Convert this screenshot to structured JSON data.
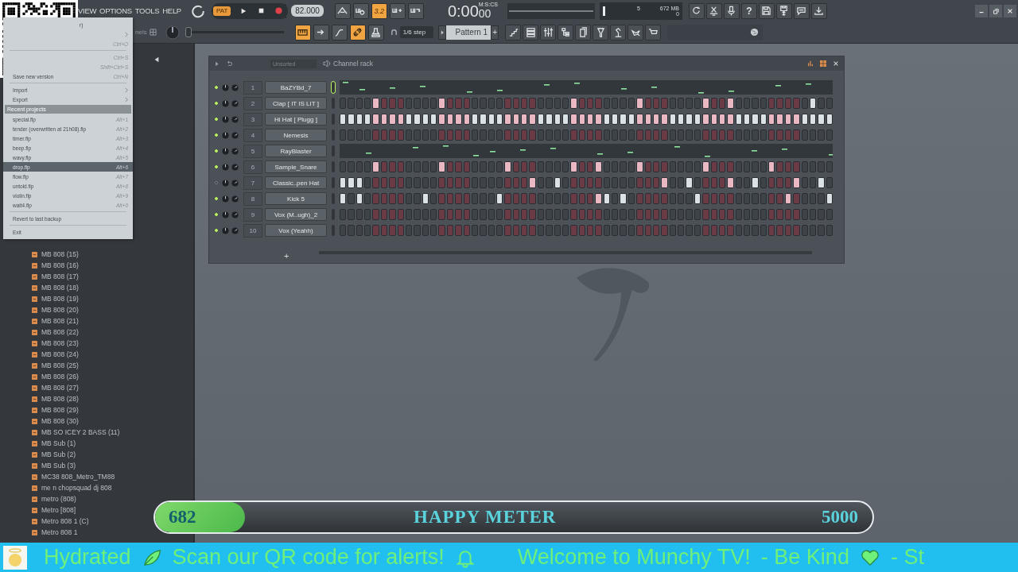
{
  "menu_bar": {
    "items": [
      "VIEW",
      "OPTIONS",
      "TOOLS",
      "HELP"
    ]
  },
  "transport": {
    "mode": "PAT",
    "tempo": "82.000"
  },
  "tools_top": [
    {
      "on": false
    },
    {
      "on": false
    },
    {
      "on": true,
      "label": "3.2"
    },
    {
      "on": false
    },
    {
      "on": false
    }
  ],
  "time": {
    "value": "0:00",
    "centis": "00",
    "unit": "M:S:CS"
  },
  "cpu": {
    "polyphony": "5",
    "memory": "672 MB",
    "value": "0"
  },
  "help_button": "?",
  "toolbar2": {
    "channels_label": "nels",
    "master_slider": {
      "level": 0
    },
    "snap": "1/6 step",
    "pattern": "Pattern 1",
    "add": "+"
  },
  "tools_bottom": [
    {
      "on": true
    },
    {
      "on": false
    },
    {
      "on": false
    },
    {
      "on": true
    },
    {
      "on": false
    }
  ],
  "file_menu": {
    "items": [
      {
        "kind": "item",
        "tail": "r)",
        "selected": false
      },
      {
        "kind": "item",
        "submenu": true,
        "selected": false
      },
      {
        "kind": "item",
        "shortcut": "Ctrl+O",
        "selected": false
      },
      {
        "kind": "separator"
      },
      {
        "kind": "item",
        "shortcut": "Ctrl+S",
        "selected": false
      },
      {
        "kind": "item",
        "shortcut": "Shift+Ctrl+S",
        "selected": false
      },
      {
        "kind": "item",
        "label": "Save new version",
        "shortcut": "Ctrl+N",
        "selected": false
      },
      {
        "kind": "separator"
      },
      {
        "kind": "item",
        "label": "Import",
        "submenu": true,
        "selected": false
      },
      {
        "kind": "item",
        "label": "Export",
        "submenu": true,
        "selected": false
      },
      {
        "kind": "header",
        "label": "Recent projects"
      },
      {
        "kind": "item",
        "label": "special.flp",
        "shortcut": "Alt+1",
        "selected": false
      },
      {
        "kind": "item",
        "label": "tender (overwritten at 21h08).flp",
        "shortcut": "Alt+2",
        "selected": false
      },
      {
        "kind": "item",
        "label": "timer.flp",
        "shortcut": "Alt+3",
        "selected": false
      },
      {
        "kind": "item",
        "label": "beep.flp",
        "shortcut": "Alt+4",
        "selected": false
      },
      {
        "kind": "item",
        "label": "wavy.flp",
        "shortcut": "Alt+5",
        "selected": false
      },
      {
        "kind": "item",
        "label": "drop.flp",
        "shortcut": "Alt+6",
        "selected": true
      },
      {
        "kind": "item",
        "label": "flow.flp",
        "shortcut": "Alt+7",
        "selected": false
      },
      {
        "kind": "item",
        "label": "untold.flp",
        "shortcut": "Alt+8",
        "selected": false
      },
      {
        "kind": "item",
        "label": "violin.flp",
        "shortcut": "Alt+9",
        "selected": false
      },
      {
        "kind": "item",
        "label": "wait4.flp",
        "shortcut": "Alt+0",
        "selected": false
      },
      {
        "kind": "separator"
      },
      {
        "kind": "item",
        "label": "Revert to last backup",
        "selected": false
      },
      {
        "kind": "separator"
      },
      {
        "kind": "item",
        "label": "Exit",
        "selected": false
      }
    ]
  },
  "browser": {
    "items": [
      "MB 808 (15)",
      "MB 808 (16)",
      "MB 808 (17)",
      "MB 808 (18)",
      "MB 808 (19)",
      "MB 808 (20)",
      "MB 808 (21)",
      "MB 808 (22)",
      "MB 808 (23)",
      "MB 808 (24)",
      "MB 808 (25)",
      "MB 808 (26)",
      "MB 808 (27)",
      "MB 808 (28)",
      "MB 808 (29)",
      "MB 808 (30)",
      "MB SO ICEY 2 BASS (11)",
      "MB Sub (1)",
      "MB Sub (2)",
      "MB Sub (3)",
      "MC38 808_Metro_TM88",
      "me n chopsquad dj 808",
      "metro (808)",
      "Metro [808]",
      "Metro 808 1 (C)",
      "Metro 808 1"
    ]
  },
  "channel_rack": {
    "filter": "Unsorted",
    "title": "Channel rack",
    "add": "+",
    "channels": [
      {
        "number": "1",
        "name": "BaZYBd_7",
        "enabled": true,
        "kind": "pianoroll"
      },
      {
        "number": "2",
        "name": "Clap [ IT IS LIT ]",
        "enabled": true,
        "kind": "steps",
        "steps": [
          false,
          false,
          false,
          false,
          true,
          false,
          false,
          false,
          false,
          false,
          false,
          false,
          true,
          false,
          false,
          false,
          false,
          false,
          false,
          false,
          false,
          false,
          false,
          false,
          false,
          false,
          false,
          false,
          true,
          false,
          false,
          false,
          false,
          false,
          false,
          false,
          true,
          false,
          false,
          false,
          false,
          false,
          false,
          false,
          true,
          false,
          false,
          true,
          false,
          false,
          false,
          false,
          false,
          false,
          false,
          false,
          false,
          true,
          false,
          false
        ]
      },
      {
        "number": "3",
        "name": "Hi Hat [ Plugg ]",
        "enabled": true,
        "kind": "steps",
        "steps": [
          true,
          true,
          true,
          true,
          true,
          true,
          true,
          true,
          true,
          true,
          true,
          true,
          true,
          true,
          true,
          true,
          true,
          true,
          true,
          true,
          true,
          true,
          true,
          true,
          true,
          true,
          true,
          true,
          true,
          true,
          true,
          true,
          true,
          true,
          true,
          true,
          true,
          true,
          true,
          true,
          true,
          true,
          true,
          true,
          true,
          true,
          true,
          true,
          true,
          true,
          true,
          true,
          true,
          true,
          true,
          true,
          true,
          true,
          true,
          true
        ]
      },
      {
        "number": "4",
        "name": "Nemesis",
        "enabled": true,
        "kind": "steps",
        "steps": [
          false,
          false,
          false,
          false,
          false,
          false,
          false,
          false,
          false,
          false,
          false,
          false,
          false,
          false,
          false,
          false,
          false,
          false,
          false,
          false,
          false,
          false,
          false,
          false,
          false,
          false,
          false,
          false,
          false,
          false,
          false,
          false,
          false,
          false,
          false,
          false,
          false,
          false,
          false,
          false,
          false,
          false,
          false,
          false,
          false,
          false,
          false,
          false,
          false,
          false,
          false,
          false,
          false,
          false,
          false,
          false,
          false,
          false,
          false,
          false
        ]
      },
      {
        "number": "5",
        "name": "RayBlaster",
        "enabled": true,
        "kind": "pianoroll"
      },
      {
        "number": "6",
        "name": "Sample_Snare",
        "enabled": true,
        "kind": "steps",
        "steps": [
          false,
          false,
          false,
          false,
          true,
          false,
          false,
          false,
          false,
          false,
          false,
          false,
          true,
          false,
          false,
          false,
          false,
          false,
          false,
          false,
          true,
          false,
          false,
          false,
          false,
          false,
          false,
          false,
          true,
          false,
          false,
          true,
          false,
          false,
          false,
          false,
          true,
          false,
          false,
          false,
          false,
          false,
          false,
          false,
          true,
          false,
          false,
          false,
          false,
          false,
          false,
          false,
          true,
          false,
          false,
          false,
          false,
          false,
          false,
          false
        ]
      },
      {
        "number": "7",
        "name": "Classic..pen Hat",
        "enabled": false,
        "kind": "steps",
        "steps": [
          true,
          true,
          true,
          false,
          false,
          false,
          false,
          false,
          false,
          false,
          false,
          false,
          false,
          false,
          false,
          false,
          false,
          false,
          false,
          false,
          false,
          false,
          false,
          true,
          false,
          false,
          true,
          false,
          false,
          false,
          false,
          false,
          false,
          false,
          false,
          false,
          false,
          false,
          false,
          true,
          false,
          false,
          true,
          false,
          false,
          false,
          false,
          true,
          false,
          false,
          true,
          false,
          false,
          false,
          false,
          true,
          false,
          false,
          true,
          false
        ]
      },
      {
        "number": "8",
        "name": "Kick 5",
        "enabled": true,
        "kind": "steps",
        "steps": [
          true,
          false,
          true,
          false,
          false,
          false,
          false,
          false,
          false,
          false,
          true,
          false,
          false,
          false,
          false,
          false,
          false,
          false,
          false,
          true,
          false,
          false,
          false,
          false,
          false,
          false,
          false,
          false,
          false,
          false,
          false,
          true,
          true,
          false,
          true,
          false,
          false,
          false,
          false,
          false,
          false,
          false,
          false,
          true,
          false,
          false,
          false,
          false,
          false,
          false,
          false,
          false,
          false,
          false,
          true,
          false,
          false,
          false,
          false,
          true
        ]
      },
      {
        "number": "9",
        "name": "Vox (M..ugh)_2",
        "enabled": true,
        "kind": "steps",
        "steps": [
          false,
          false,
          false,
          false,
          false,
          false,
          false,
          false,
          false,
          false,
          false,
          false,
          false,
          false,
          false,
          false,
          false,
          false,
          false,
          false,
          false,
          false,
          false,
          false,
          false,
          false,
          false,
          false,
          false,
          false,
          false,
          false,
          false,
          false,
          false,
          false,
          false,
          false,
          false,
          false,
          false,
          false,
          false,
          false,
          false,
          false,
          false,
          false,
          false,
          false,
          false,
          false,
          false,
          false,
          false,
          false,
          false,
          false,
          false,
          false
        ]
      },
      {
        "number": "10",
        "name": "Vox (Yeahh)",
        "enabled": true,
        "kind": "steps",
        "steps": [
          false,
          false,
          false,
          false,
          false,
          false,
          false,
          false,
          false,
          false,
          false,
          false,
          false,
          false,
          false,
          false,
          false,
          false,
          false,
          false,
          false,
          false,
          false,
          false,
          false,
          false,
          false,
          false,
          false,
          false,
          false,
          false,
          false,
          false,
          false,
          false,
          false,
          false,
          false,
          false,
          false,
          false,
          false,
          false,
          false,
          false,
          false,
          false,
          false,
          false,
          false,
          false,
          false,
          false,
          false,
          false,
          false,
          false,
          false,
          false
        ]
      }
    ]
  },
  "happy_meter": {
    "value": "682",
    "label": "HAPPY METER",
    "max": "5000",
    "level": 0.125
  },
  "ticker": {
    "texts": [
      "Hydrated",
      "Scan our QR code for alerts!",
      "Welcome to Munchy TV!",
      "- Be Kind",
      "- St"
    ]
  }
}
